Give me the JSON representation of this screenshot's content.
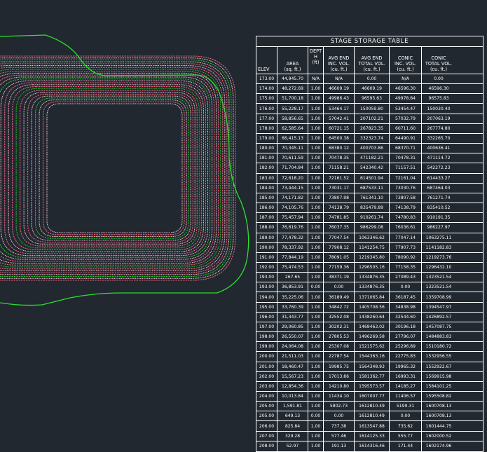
{
  "colors": {
    "background": "#212830",
    "outline": "#2ee02e",
    "contour_red": "#e8607a",
    "contour_pink": "#f4b8c8",
    "contour_green": "#1fc41f",
    "table_line": "#ffffff"
  },
  "table": {
    "title": "STAGE STORAGE TABLE",
    "headers": [
      {
        "lines": [
          "ELEV"
        ]
      },
      {
        "lines": [
          "AREA",
          "(sq. ft.)"
        ]
      },
      {
        "lines": [
          "DEPT",
          "H",
          "(ft)"
        ]
      },
      {
        "lines": [
          "AVG END",
          "INC. VOL.",
          "(cu. ft.)"
        ]
      },
      {
        "lines": [
          "AVG END",
          "TOTAL VOL.",
          "(cu. ft.)"
        ]
      },
      {
        "lines": [
          "CONIC",
          "INC. VOL.",
          "(cu. ft.)"
        ]
      },
      {
        "lines": [
          "CONIC",
          "TOTAL VOL.",
          "(cu. ft.)"
        ]
      }
    ],
    "rows": [
      [
        "173.00",
        "44,945.70",
        "N/A",
        "N/A",
        "0.00",
        "N/A",
        "0.00"
      ],
      [
        "174.00",
        "48,272.69",
        "1.00",
        "46609.19",
        "46609.19",
        "46596.30",
        "46596.30"
      ],
      [
        "175.00",
        "51,700.18",
        "1.00",
        "49986.43",
        "96595.63",
        "49978.84",
        "96575.83"
      ],
      [
        "176.00",
        "55,228.17",
        "1.00",
        "53464.17",
        "150059.80",
        "53454.47",
        "150030.40"
      ],
      [
        "177.00",
        "58,856.65",
        "1.00",
        "57042.41",
        "207102.21",
        "57032.79",
        "207063.19"
      ],
      [
        "178.00",
        "62,585.64",
        "1.00",
        "60721.15",
        "267823.35",
        "60711.60",
        "267774.80"
      ],
      [
        "179.00",
        "66,415.13",
        "1.00",
        "64500.38",
        "332323.74",
        "64490.91",
        "332265.70"
      ],
      [
        "180.00",
        "70,345.11",
        "1.00",
        "68380.12",
        "400703.86",
        "68370.71",
        "400636.41"
      ],
      [
        "181.00",
        "70,611.59",
        "1.00",
        "70478.35",
        "471182.21",
        "70478.31",
        "471114.72"
      ],
      [
        "182.00",
        "71,704.84",
        "1.00",
        "71158.21",
        "542340.42",
        "71157.51",
        "542272.23"
      ],
      [
        "183.00",
        "72,618.20",
        "1.00",
        "72161.52",
        "614501.94",
        "72161.04",
        "614433.27"
      ],
      [
        "184.00",
        "73,444.15",
        "1.00",
        "73031.17",
        "687533.11",
        "73030.76",
        "687464.03"
      ],
      [
        "185.00",
        "74,171.82",
        "1.00",
        "73807.98",
        "761341.10",
        "73807.58",
        "761271.74"
      ],
      [
        "186.00",
        "74,105.76",
        "1.00",
        "74138.79",
        "835479.89",
        "74138.79",
        "835410.52"
      ],
      [
        "187.00",
        "75,457.94",
        "1.00",
        "74781.85",
        "910261.74",
        "74780.83",
        "910191.35"
      ],
      [
        "188.00",
        "76,619.76",
        "1.00",
        "76037.35",
        "986299.08",
        "76036.61",
        "986227.97"
      ],
      [
        "189.00",
        "77,478.32",
        "1.00",
        "77047.54",
        "1063346.62",
        "77047.14",
        "1063275.11"
      ],
      [
        "190.00",
        "78,337.92",
        "1.00",
        "77908.12",
        "1141254.75",
        "77907.73",
        "1141182.83"
      ],
      [
        "191.00",
        "77,844.19",
        "1.00",
        "78091.05",
        "1219345.80",
        "78090.92",
        "1219273.76"
      ],
      [
        "192.00",
        "75,474.53",
        "1.00",
        "77159.36",
        "1296505.16",
        "77158.35",
        "1296432.10"
      ],
      [
        "193.00",
        "267.65",
        "1.00",
        "38371.19",
        "1334876.35",
        "27089.43",
        "1323521.54"
      ],
      [
        "193.00",
        "36,853.91",
        "0.00",
        "0.00",
        "1334876.35",
        "0.00",
        "1323521.54"
      ],
      [
        "194.00",
        "35,225.06",
        "1.00",
        "36189.49",
        "1371065.84",
        "36187.45",
        "1359708.99"
      ],
      [
        "195.00",
        "33,760.39",
        "1.00",
        "34842.72",
        "1405708.56",
        "34838.98",
        "1394547.97"
      ],
      [
        "196.00",
        "31,343.77",
        "1.00",
        "32552.08",
        "1438260.64",
        "32544.60",
        "1426892.57"
      ],
      [
        "197.00",
        "29,060.85",
        "1.00",
        "30202.31",
        "1468463.02",
        "30196.18",
        "1457087.75"
      ],
      [
        "198.00",
        "26,550.07",
        "1.00",
        "27805.53",
        "1496269.58",
        "27796.07",
        "1484883.83"
      ],
      [
        "199.00",
        "24,064.08",
        "1.00",
        "25307.08",
        "1521575.62",
        "25296.89",
        "1510180.72"
      ],
      [
        "200.00",
        "21,511.03",
        "1.00",
        "22787.54",
        "1544363.16",
        "22775.83",
        "1532956.55"
      ],
      [
        "201.00",
        "18,460.47",
        "1.00",
        "19985.75",
        "1564348.93",
        "19965.32",
        "1552922.67"
      ],
      [
        "202.00",
        "15,567.23",
        "1.00",
        "17013.86",
        "1581362.77",
        "16993.31",
        "1569915.98"
      ],
      [
        "203.00",
        "12,854.36",
        "1.00",
        "14210.80",
        "1595573.57",
        "14185.27",
        "1584101.25"
      ],
      [
        "204.00",
        "10,013.84",
        "1.00",
        "11434.10",
        "1607007.77",
        "11406.57",
        "1595508.82"
      ],
      [
        "205.00",
        "1,591.81",
        "1.00",
        "5802.73",
        "1612810.49",
        "5199.31",
        "1600708.13"
      ],
      [
        "205.00",
        "649.13",
        "0.00",
        "0.00",
        "1612810.49",
        "0.00",
        "1600708.13"
      ],
      [
        "206.00",
        "825.84",
        "1.00",
        "737.38",
        "1613547.88",
        "735.62",
        "1601444.75"
      ],
      [
        "207.00",
        "329.28",
        "1.00",
        "577.46",
        "1614125.33",
        "555.77",
        "1602000.52"
      ],
      [
        "208.00",
        "52.97",
        "1.00",
        "191.13",
        "1614316.46",
        "171.44",
        "1602174.96"
      ]
    ]
  }
}
